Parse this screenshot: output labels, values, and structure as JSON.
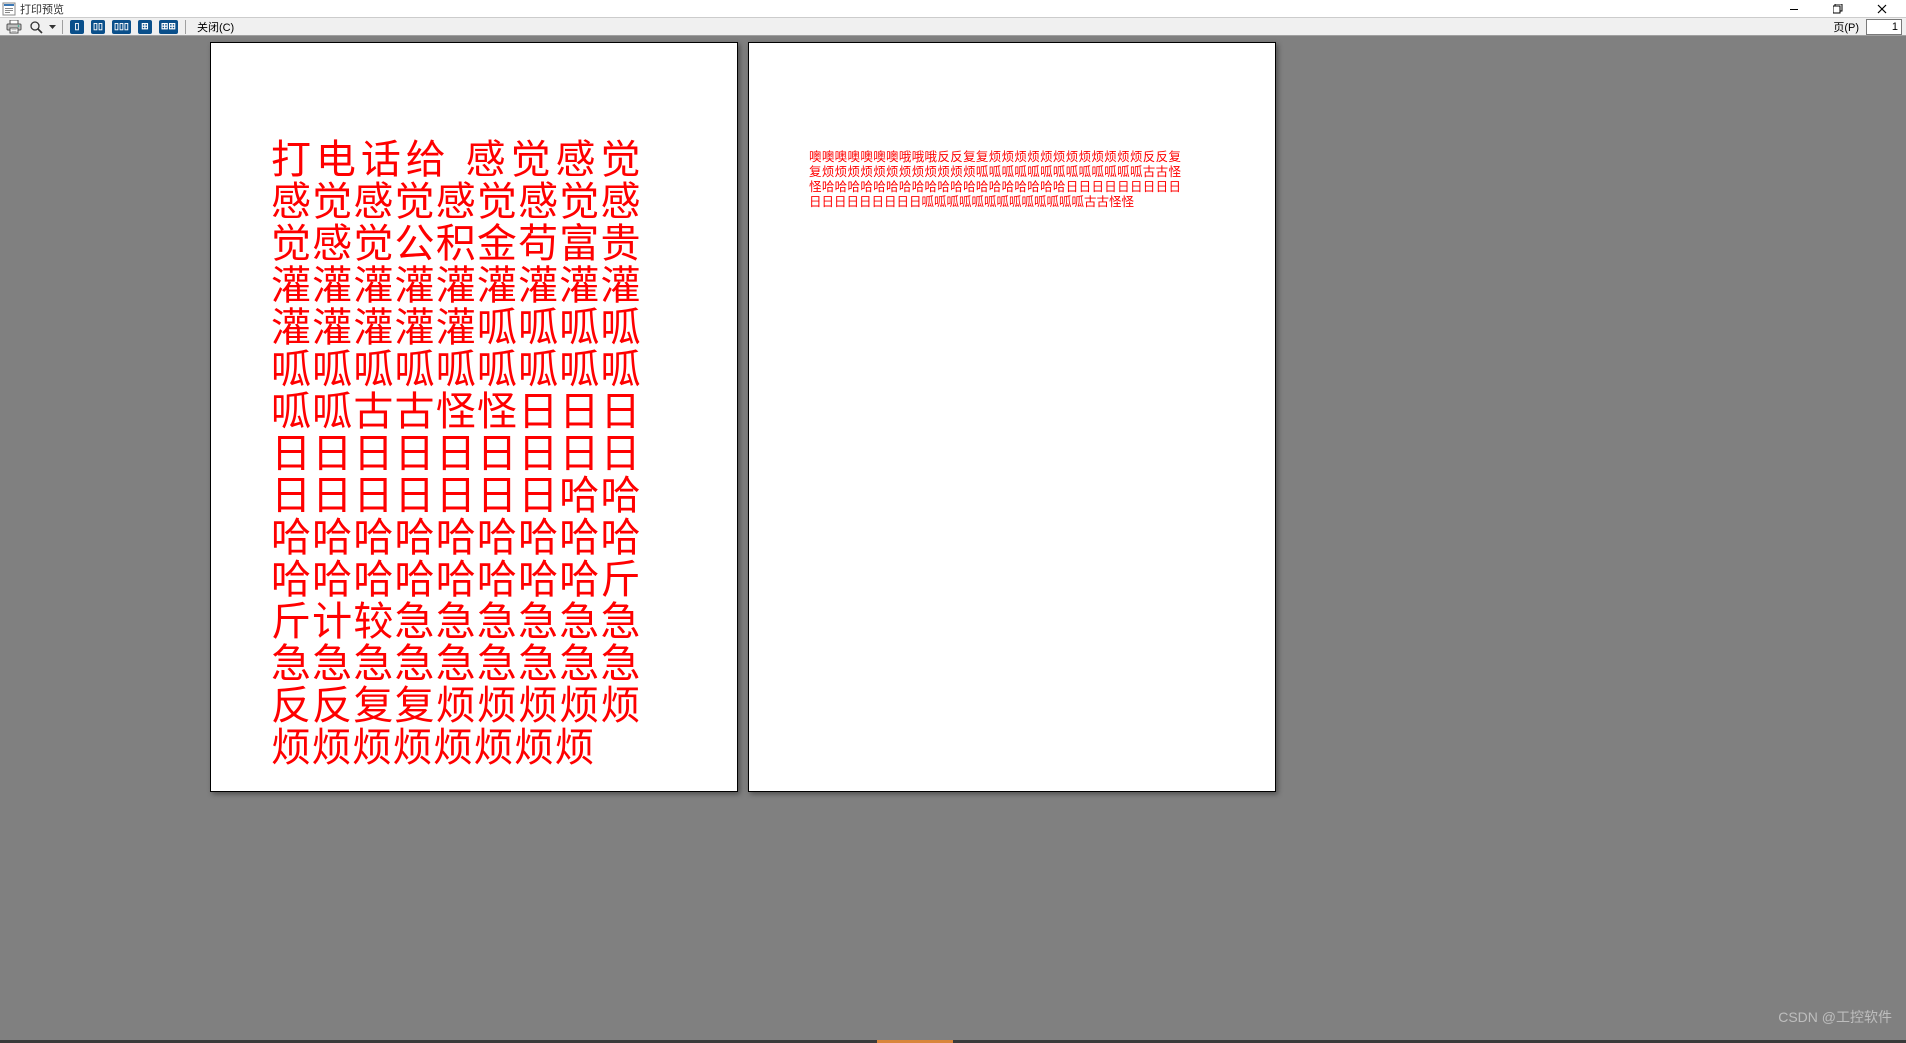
{
  "window": {
    "title": "打印预览",
    "minimize_tooltip": "最小化",
    "maximize_tooltip": "还原",
    "close_tooltip": "关闭"
  },
  "toolbar": {
    "print_tooltip": "打印",
    "zoom_tooltip": "缩放",
    "layout1_tooltip": "单页",
    "layout2_tooltip": "双页",
    "layout3_tooltip": "三页",
    "layout4_tooltip": "四页",
    "layout6_tooltip": "六页",
    "close_label": "关闭(C)",
    "page_label": "页(P)",
    "page_value": "1"
  },
  "pages": {
    "page1_text": "打电话给 感觉感觉感觉感觉感觉感觉感觉感觉公积金苟富贵灌灌灌灌灌灌灌灌灌灌灌灌灌灌呱呱呱呱呱呱呱呱呱呱呱呱呱呱呱古古怪怪日日日日日日日日日日日日日日日日日日日哈哈哈哈哈哈哈哈哈哈哈哈哈哈哈哈哈哈哈斤斤计较急急急急急急急急急急急急急急急反反复复烦烦烦烦烦烦烦烦烦烦烦烦烦",
    "page2_text": "噢噢噢噢噢噢噢哦哦哦反反复复烦烦烦烦烦烦烦烦烦烦烦烦反反复复烦烦烦烦烦烦烦烦烦烦烦烦呱呱呱呱呱呱呱呱呱呱呱呱呱古古怪怪哈哈哈哈哈哈哈哈哈哈哈哈哈哈哈哈哈哈哈日日日日日日日日日日日日日日日日日日呱呱呱呱呱呱呱呱呱呱呱呱呱古古怪怪"
  },
  "watermark": "CSDN @工控软件"
}
